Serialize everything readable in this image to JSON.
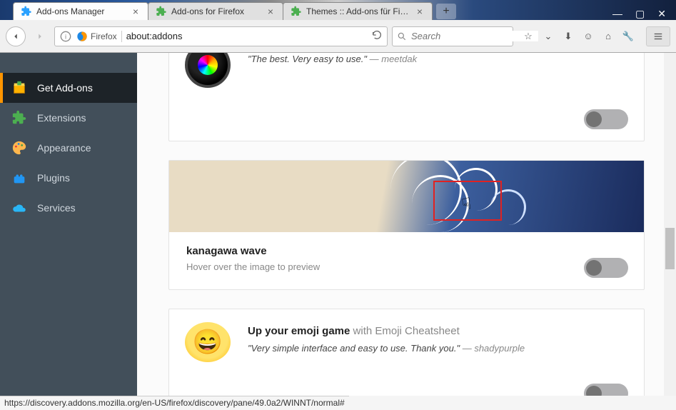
{
  "titlebar": {
    "tabs": [
      {
        "label": "Add-ons Manager",
        "icon": "puzzle-blue"
      },
      {
        "label": "Add-ons for Firefox",
        "icon": "puzzle-green"
      },
      {
        "label": "Themes :: Add-ons für Fir…",
        "icon": "puzzle-green"
      }
    ]
  },
  "navbar": {
    "badge": "Firefox",
    "url": "about:addons",
    "search_placeholder": "Search"
  },
  "sidebar": {
    "items": [
      {
        "label": "Get Add-ons"
      },
      {
        "label": "Extensions"
      },
      {
        "label": "Appearance"
      },
      {
        "label": "Plugins"
      },
      {
        "label": "Services"
      }
    ]
  },
  "cards": {
    "c0": {
      "quote": "\"The best. Very easy to use.\"",
      "author": "— meetdak"
    },
    "c1": {
      "title": "kanagawa wave",
      "hint": "Hover over the image to preview"
    },
    "c2": {
      "title": "Up your emoji game",
      "subtitle": " with Emoji Cheatsheet",
      "quote": "\"Very simple interface and easy to use. Thank you.\"",
      "author": "— shadypurple"
    }
  },
  "statusbar": "https://discovery.addons.mozilla.org/en-US/firefox/discovery/pane/49.0a2/WINNT/normal#"
}
